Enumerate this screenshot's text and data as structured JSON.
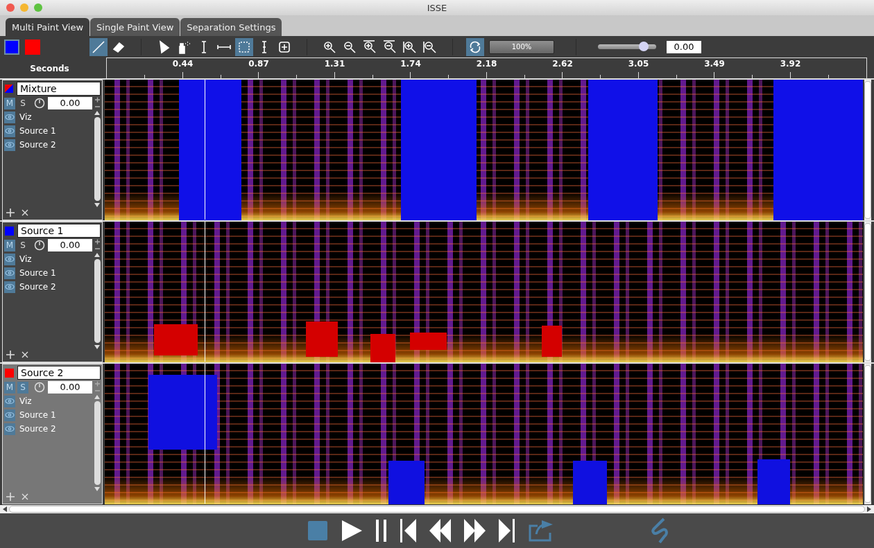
{
  "window": {
    "title": "ISSE"
  },
  "tabs": [
    {
      "label": "Multi Paint View",
      "selected": true
    },
    {
      "label": "Single Paint View",
      "selected": false
    },
    {
      "label": "Separation Settings",
      "selected": false
    }
  ],
  "toolbar": {
    "swatches": [
      {
        "color": "#0000ff",
        "selected": true
      },
      {
        "color": "#ff0000",
        "selected": false
      }
    ],
    "tools": [
      {
        "kind": "brush",
        "selected": true
      },
      {
        "kind": "eraser",
        "selected": false
      },
      {
        "kind": "sep"
      },
      {
        "kind": "pointer",
        "selected": false
      },
      {
        "kind": "spray",
        "selected": false
      },
      {
        "kind": "ibeam",
        "selected": false
      },
      {
        "kind": "hrange",
        "selected": false
      },
      {
        "kind": "rectselect",
        "selected": true
      },
      {
        "kind": "vrange",
        "selected": false
      },
      {
        "kind": "plusbox",
        "selected": false
      },
      {
        "kind": "sep"
      },
      {
        "kind": "zoomin",
        "selected": false
      },
      {
        "kind": "zoomout",
        "selected": false
      },
      {
        "kind": "hzoomin",
        "selected": false
      },
      {
        "kind": "hzoomout",
        "selected": false
      },
      {
        "kind": "vzoomin",
        "selected": false
      },
      {
        "kind": "vzoomout",
        "selected": false
      },
      {
        "kind": "sep"
      },
      {
        "kind": "loop",
        "selected": true
      }
    ],
    "progress": {
      "text": "100%"
    },
    "volume": {
      "level": 0.78,
      "value": "0.00"
    }
  },
  "ruler": {
    "label": "Seconds",
    "ticks": [
      "0.44",
      "0.87",
      "1.31",
      "1.74",
      "2.18",
      "2.62",
      "3.05",
      "3.49",
      "3.92"
    ]
  },
  "tracks": [
    {
      "name": "Mixture",
      "kind": "mixture",
      "mute_label": "M",
      "solo_label": "S",
      "mute": true,
      "solo": false,
      "gain": "0.00",
      "selected": false,
      "layers": [
        {
          "name": "Viz",
          "visible": true
        },
        {
          "name": "Source 1",
          "visible": true
        },
        {
          "name": "Source 2",
          "visible": true
        }
      ]
    },
    {
      "name": "Source 1",
      "kind": "source",
      "color": "#0000ff",
      "mute_label": "M",
      "solo_label": "S",
      "mute": true,
      "solo": false,
      "gain": "0.00",
      "selected": false,
      "layers": [
        {
          "name": "Viz",
          "visible": true
        },
        {
          "name": "Source 1",
          "visible": true
        },
        {
          "name": "Source 2",
          "visible": true
        }
      ]
    },
    {
      "name": "Source 2",
      "kind": "source",
      "color": "#ff0000",
      "mute_label": "M",
      "solo_label": "S",
      "mute": true,
      "solo": true,
      "gain": "0.00",
      "selected": true,
      "layers": [
        {
          "name": "Viz",
          "visible": true
        },
        {
          "name": "Source 1",
          "visible": true
        },
        {
          "name": "Source 2",
          "visible": true
        }
      ]
    }
  ]
}
